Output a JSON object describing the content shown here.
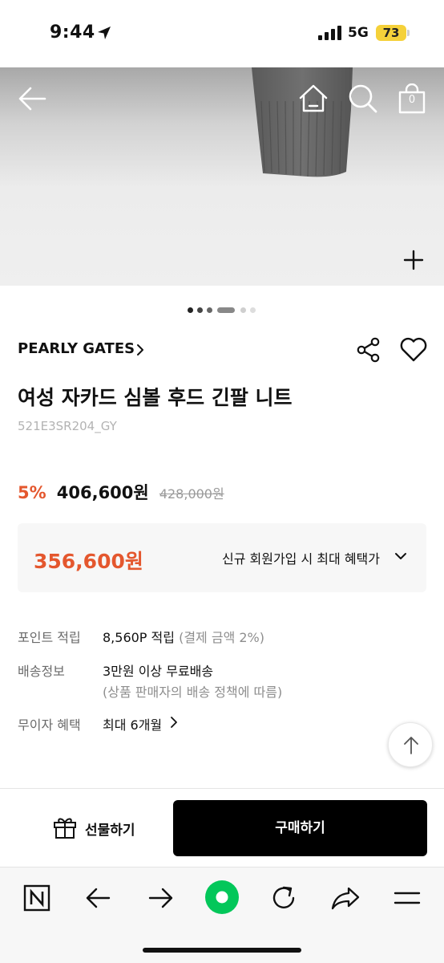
{
  "status_bar": {
    "time": "9:44",
    "network": "5G",
    "battery": "73"
  },
  "hero": {
    "cart_count": "0",
    "dot_colors": [
      "#222222",
      "#444444",
      "#666666",
      "#888888",
      "#cfcfcf",
      "#dddddd"
    ]
  },
  "product": {
    "brand": "PEARLY GATES",
    "title": "여성 자카드 심볼 후드 긴팔 니트",
    "code": "521E3SR204_GY",
    "discount_rate": "5%",
    "sale_price": "406,600원",
    "original_price": "428,000원"
  },
  "benefit": {
    "price": "356,600원",
    "link_text": "신규 회원가입 시 최대 혜택가"
  },
  "info": {
    "points_label": "포인트 적립",
    "points_value": "8,560P 적립",
    "points_note": "(결제 금액 2%)",
    "shipping_label": "배송정보",
    "shipping_value": "3만원 이상 무료배송",
    "shipping_note": "(상품 판매자의 배송 정책에 따름)",
    "installment_label": "무이자 혜택",
    "installment_value": "최대 6개월"
  },
  "actions": {
    "gift_label": "선물하기",
    "buy_label": "구매하기"
  },
  "colors": {
    "accent": "#e4572e",
    "buy_button": "#000000",
    "battery": "#f5d13a",
    "naver_green": "#03c75a"
  },
  "browser_bar": {
    "icons": [
      "naver-n-icon",
      "back-arrow-icon",
      "forward-arrow-icon",
      "green-dot-icon",
      "refresh-icon",
      "share-arrow-icon",
      "menu-icon"
    ]
  }
}
